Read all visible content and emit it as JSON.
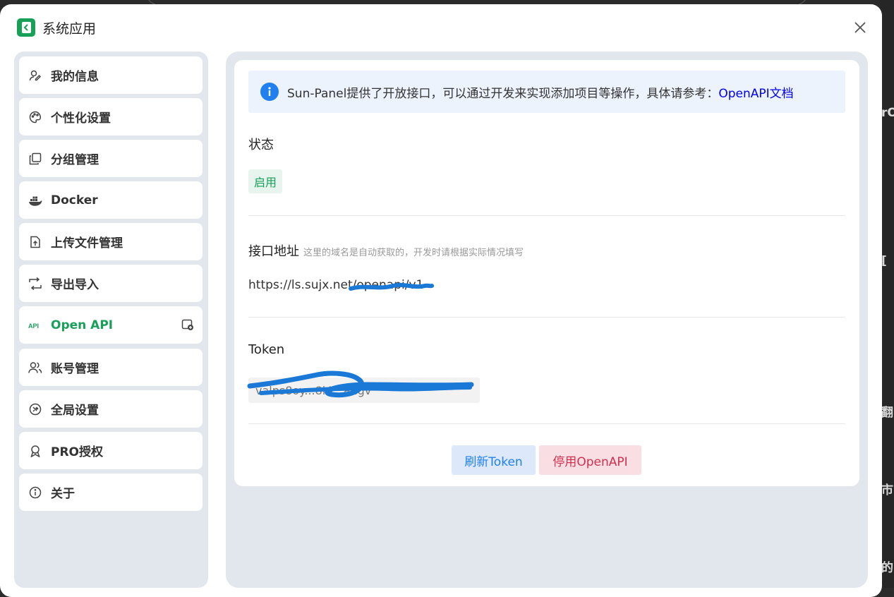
{
  "window": {
    "title": "系统应用"
  },
  "sidebar": {
    "items": [
      {
        "label": "我的信息",
        "icon": "user-edit-icon"
      },
      {
        "label": "个性化设置",
        "icon": "palette-icon"
      },
      {
        "label": "分组管理",
        "icon": "copy-icon"
      },
      {
        "label": "Docker",
        "icon": "docker-icon"
      },
      {
        "label": "上传文件管理",
        "icon": "file-upload-icon"
      },
      {
        "label": "导出导入",
        "icon": "import-export-icon"
      },
      {
        "label": "Open API",
        "icon": "api-icon",
        "active": true
      },
      {
        "label": "账号管理",
        "icon": "users-icon"
      },
      {
        "label": "全局设置",
        "icon": "settings-icon"
      },
      {
        "label": "PRO授权",
        "icon": "award-icon"
      },
      {
        "label": "关于",
        "icon": "info-icon"
      }
    ]
  },
  "main": {
    "alert": {
      "text": "Sun-Panel提供了开放接口，可以通过开发来实现添加项目等操作，具体请参考：",
      "link": "OpenAPI文档"
    },
    "status": {
      "label": "状态",
      "value": "启用"
    },
    "endpoint": {
      "label": "接口地址",
      "hint": "这里的域名是自动获取的，开发时请根据实际情况填写",
      "url": "https://ls.sujx.net/openapi/v1"
    },
    "token": {
      "label": "Token",
      "value": "valps8oy...8i4...angv"
    },
    "buttons": {
      "refresh": "刷新Token",
      "disable": "停用OpenAPI"
    }
  },
  "background": {
    "fragments": [
      "rO",
      "[",
      "翻",
      "市",
      "的"
    ]
  },
  "colors": {
    "accent": "#18a058",
    "info": "#2080f0",
    "danger": "#d03050",
    "sidebar_bg": "#e2e6ed"
  }
}
